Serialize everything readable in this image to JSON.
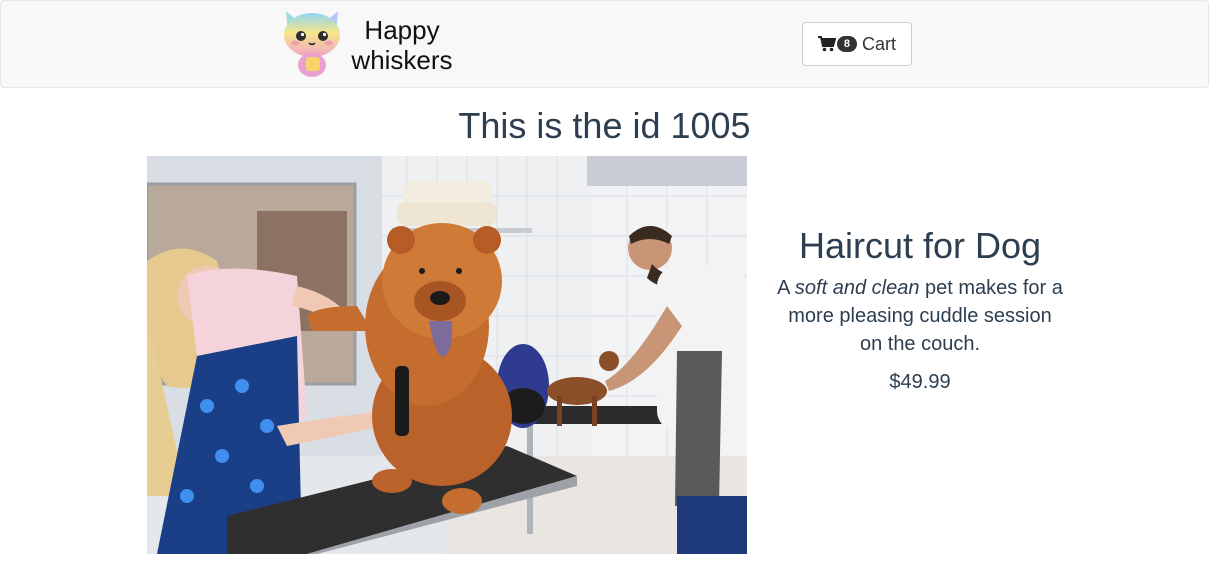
{
  "navbar": {
    "brand_line1": "Happy",
    "brand_line2": "whiskers",
    "cart_count": "8",
    "cart_label": "Cart",
    "logo_icon": "rainbow-cat-icon",
    "cart_icon": "shopping-cart-icon"
  },
  "page": {
    "title": "This is the id 1005"
  },
  "product": {
    "name": "Haircut for Dog",
    "desc_before": "A ",
    "desc_emphasis": "soft and clean",
    "desc_after": " pet makes for a more pleasing cuddle session on the couch.",
    "price": "$49.99"
  },
  "colors": {
    "text": "#2c3e50",
    "navbar_bg": "#f8f8f8",
    "badge_bg": "#333333"
  }
}
